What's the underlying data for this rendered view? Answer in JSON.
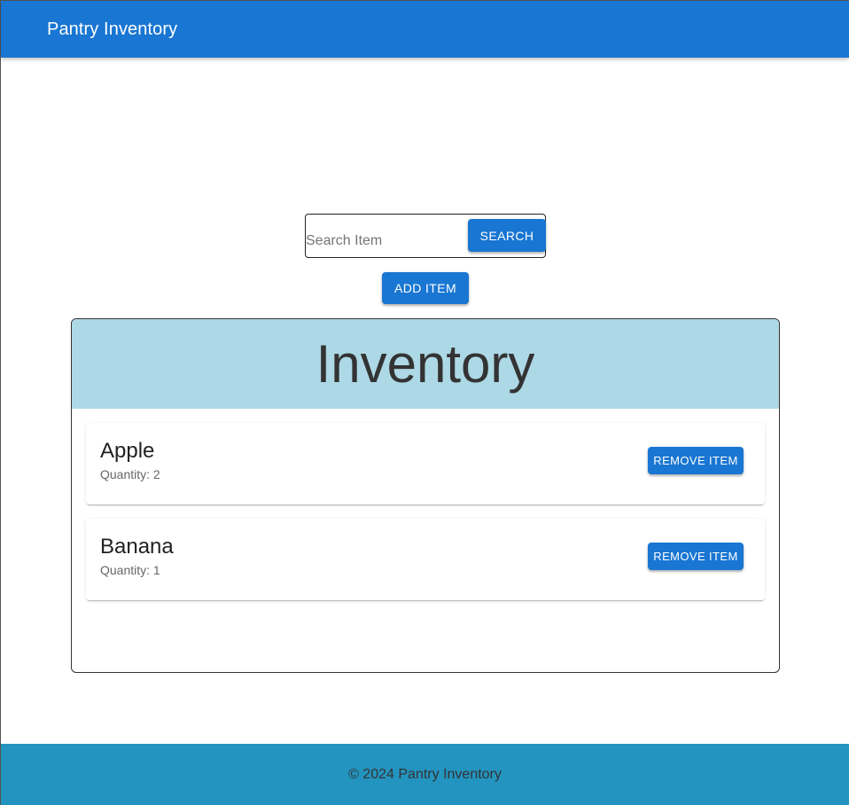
{
  "appbar": {
    "title": "Pantry Inventory"
  },
  "search": {
    "placeholder": "Search Item",
    "value": "",
    "button_label": "SEARCH"
  },
  "actions": {
    "add_label": "ADD ITEM"
  },
  "inventory": {
    "title": "Inventory",
    "items": [
      {
        "name": "Apple",
        "quantity_text": "Quantity: 2",
        "remove_label": "REMOVE ITEM"
      },
      {
        "name": "Banana",
        "quantity_text": "Quantity: 1",
        "remove_label": "REMOVE ITEM"
      }
    ]
  },
  "footer": {
    "text": "© 2024 Pantry Inventory"
  },
  "colors": {
    "primary": "#1976d2",
    "inventory_header": "#add8e6",
    "footer": "#2394bf"
  }
}
